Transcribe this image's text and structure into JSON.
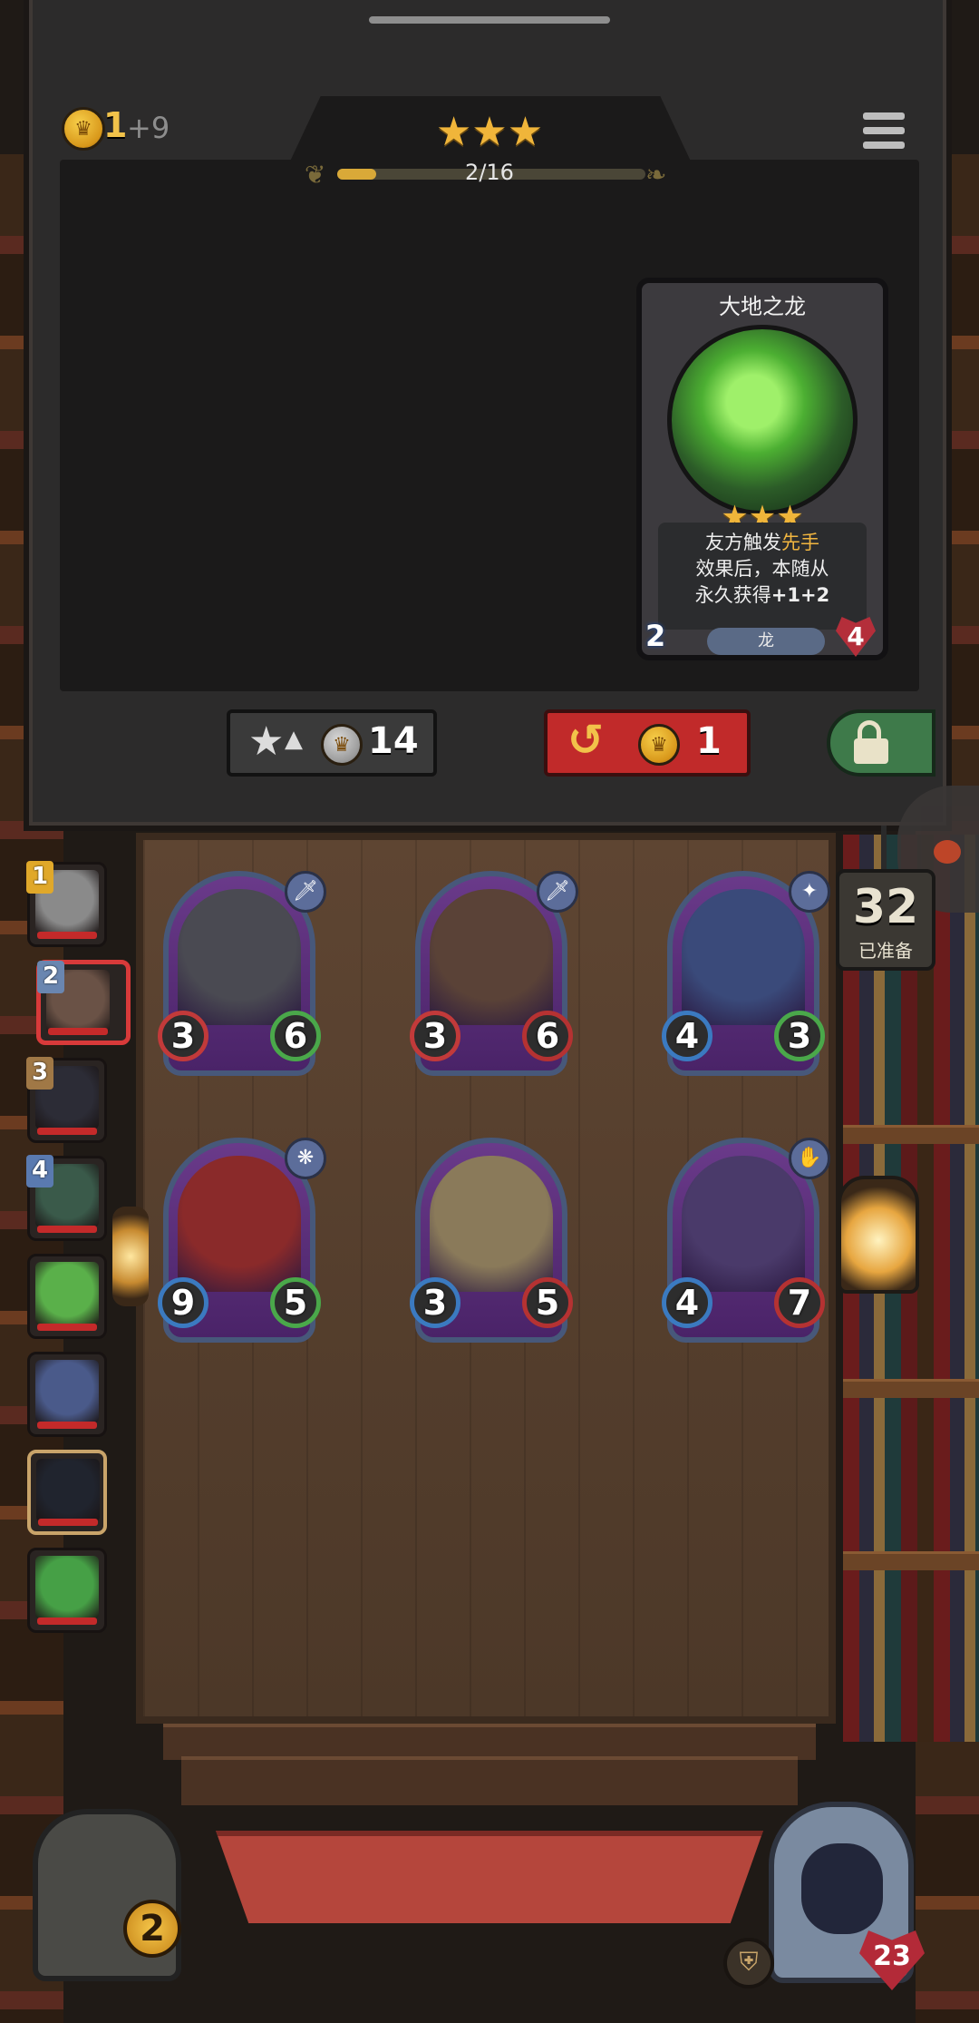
{
  "header": {
    "gold": "1",
    "gold_income": "+9",
    "stars": 3,
    "progress_text": "2/16",
    "progress_fraction": 0.125
  },
  "featured_card": {
    "name": "大地之龙",
    "stars": 3,
    "desc_line1_a": "友方触发",
    "desc_line1_b": "先手",
    "desc_line2": "效果后，本随从",
    "desc_line3_a": "永久获得",
    "desc_line3_b": "+1+2",
    "tribe": "龙",
    "attack": "2",
    "health": "4"
  },
  "actions": {
    "upgrade_cost": "14",
    "refresh_cost": "1"
  },
  "deck": {
    "count": "32",
    "label": "已准备"
  },
  "minions": [
    {
      "attack": "3",
      "health": "6",
      "tribe_icon": "sword-icon",
      "art": "#4a4a52"
    },
    {
      "attack": "3",
      "health": "6",
      "tribe_icon": "sword-icon",
      "art": "#5a4237"
    },
    {
      "attack": "4",
      "health": "3",
      "tribe_icon": "star-icon",
      "art": "#3a4a7a"
    },
    {
      "attack": "9",
      "health": "5",
      "tribe_icon": "dragon-icon",
      "art": "#8a2a2a"
    },
    {
      "attack": "3",
      "health": "5",
      "tribe_icon": "",
      "art": "#8a7a5a"
    },
    {
      "attack": "4",
      "health": "7",
      "tribe_icon": "claw-icon",
      "art": "#4a3a6a"
    }
  ],
  "players": [
    {
      "rank": "1",
      "face": "#8a8a8a",
      "selected": false
    },
    {
      "rank": "2",
      "face": "#6a5246",
      "selected": true
    },
    {
      "rank": "3",
      "face": "#2c2c36",
      "selected": false
    },
    {
      "rank": "4",
      "face": "#3a5a4a",
      "selected": false
    },
    {
      "rank": "",
      "face": "#5ab04a",
      "selected": false
    },
    {
      "rank": "",
      "face": "#4a5a8a",
      "selected": false
    },
    {
      "rank": "",
      "face": "#20242e",
      "selected": false
    },
    {
      "rank": "",
      "face": "#46a046",
      "selected": false
    }
  ],
  "hero": {
    "level": "2",
    "health": "23"
  }
}
